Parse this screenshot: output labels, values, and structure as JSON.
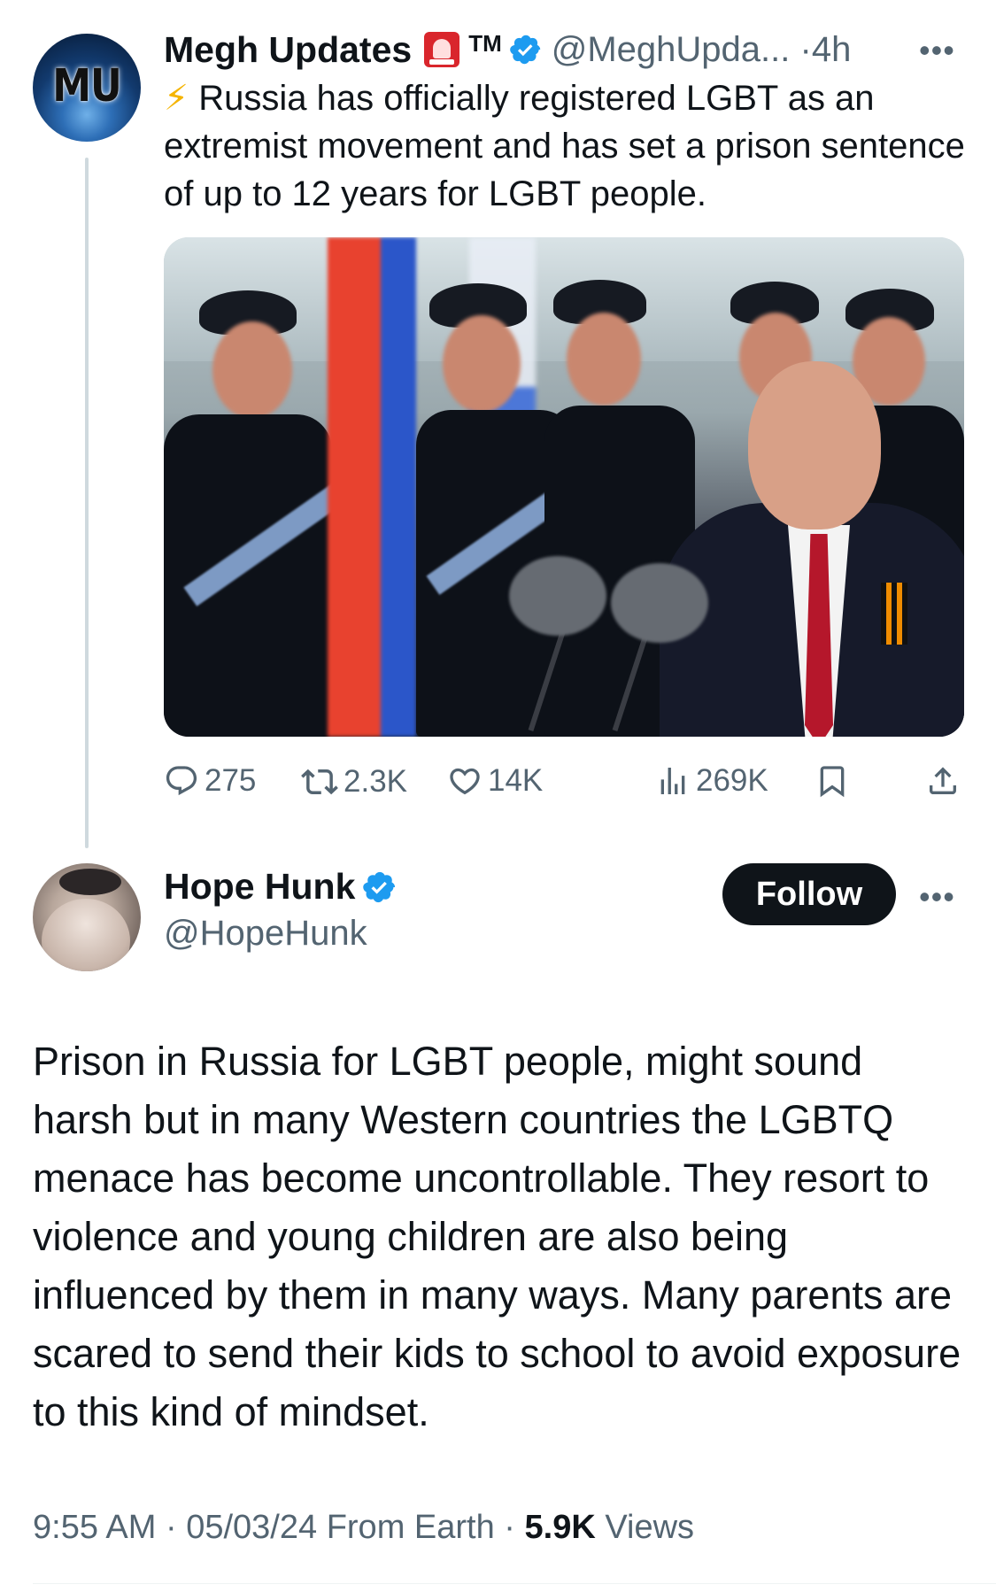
{
  "parent_tweet": {
    "author_name": "Megh Updates",
    "tm": "TM",
    "handle": "@MeghUpda...",
    "separator": "·",
    "time": "4h",
    "avatar_text": "MU",
    "text": "⚡ Russia has officially registered LGBT as an extremist movement and has set a prison sentence of up to 12 years for LGBT people.",
    "actions": {
      "replies": "275",
      "reposts": "2.3K",
      "likes": "14K",
      "views": "269K"
    }
  },
  "main_tweet": {
    "author_name": "Hope Hunk",
    "handle": "@HopeHunk",
    "follow_label": "Follow",
    "text": "Prison in Russia for LGBT people, might sound harsh but in many Western countries the LGBTQ menace has become uncontrollable. They resort to violence and young children are also being influenced by them in many ways. Many parents are scared to send their kids to school to avoid exposure to this kind of mindset.",
    "time": "9:55 AM",
    "date": "05/03/24",
    "source": "From Earth",
    "views_count": "5.9K",
    "views_label": "Views"
  },
  "colors": {
    "text": "#0f1419",
    "secondary": "#536471",
    "verified": "#1d9bf0",
    "follow_bg": "#0f1419"
  }
}
